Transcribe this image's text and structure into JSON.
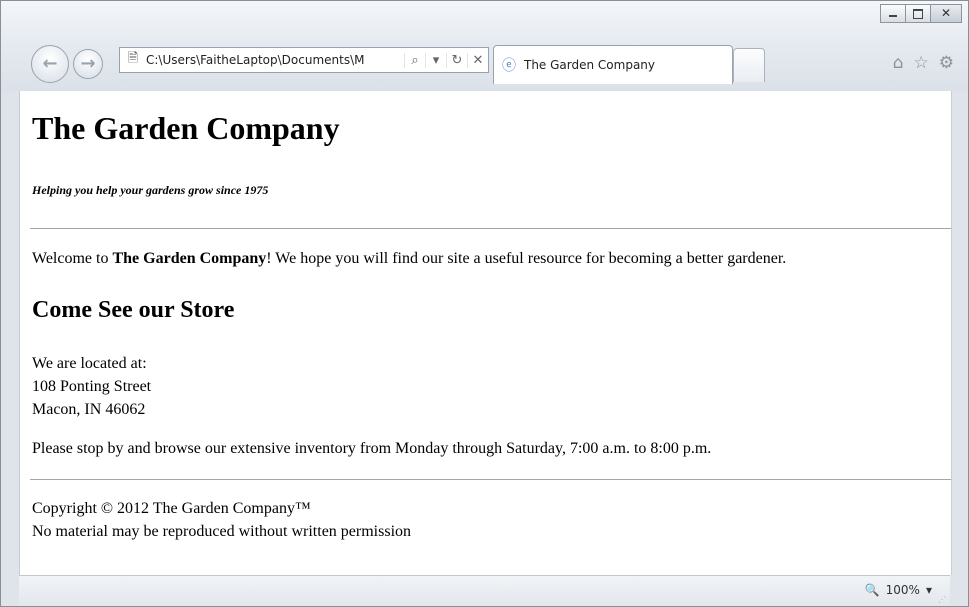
{
  "browser": {
    "address": "C:\\Users\\FaitheLaptop\\Documents\\M",
    "tab_title": "The Garden Company",
    "zoom": "100%"
  },
  "page": {
    "title": "The Garden Company",
    "tagline": "Helping you help your gardens grow since 1975",
    "welcome_prefix": "Welcome to ",
    "welcome_bold": "The Garden Company",
    "welcome_suffix": "! We hope you will find our site a useful resource for becoming a better gardener.",
    "store_heading": "Come See our Store",
    "located_label": "We are located at:",
    "street": "108 Ponting Street",
    "city": "Macon, IN 46062",
    "hours": "Please stop by and browse our extensive inventory from Monday through Saturday, 7:00 a.m. to 8:00 p.m.",
    "copyright": "Copyright © 2012 The Garden Company™",
    "permission": "No material may be reproduced without written permission"
  },
  "icons": {
    "back": "back-arrow-icon",
    "forward": "forward-arrow-icon",
    "page": "page-icon",
    "search": "search-icon",
    "dropdown": "dropdown-icon",
    "refresh": "refresh-icon",
    "stop": "stop-icon",
    "ie": "ie-logo-icon",
    "home": "home-icon",
    "favorites": "star-icon",
    "tools": "gear-icon"
  }
}
